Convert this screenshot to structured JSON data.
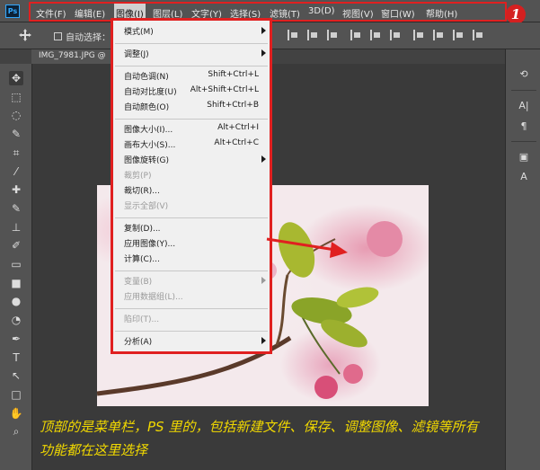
{
  "menubar": {
    "logo": "Ps",
    "items": [
      "文件(F)",
      "编辑(E)",
      "图像(I)",
      "图层(L)",
      "文字(Y)",
      "选择(S)",
      "滤镜(T)",
      "3D(D)",
      "视图(V)",
      "窗口(W)",
      "帮助(H)"
    ],
    "active": "图像(I)",
    "highlight_color": "#e02020"
  },
  "step_badge": "1",
  "optionsbar": {
    "auto_select_label": "自动选择："
  },
  "document_tab": "IMG_7981.JPG @",
  "dropdown": {
    "border_color": "#e02020",
    "groups": [
      [
        {
          "label": "模式(M)",
          "submenu": true,
          "enabled": true
        }
      ],
      [
        {
          "label": "调整(J)",
          "submenu": true,
          "enabled": true
        }
      ],
      [
        {
          "label": "自动色调(N)",
          "shortcut": "Shift+Ctrl+L",
          "enabled": true
        },
        {
          "label": "自动对比度(U)",
          "shortcut": "Alt+Shift+Ctrl+L",
          "enabled": true
        },
        {
          "label": "自动颜色(O)",
          "shortcut": "Shift+Ctrl+B",
          "enabled": true
        }
      ],
      [
        {
          "label": "图像大小(I)...",
          "shortcut": "Alt+Ctrl+I",
          "enabled": true
        },
        {
          "label": "画布大小(S)...",
          "shortcut": "Alt+Ctrl+C",
          "enabled": true
        },
        {
          "label": "图像旋转(G)",
          "submenu": true,
          "enabled": true
        },
        {
          "label": "裁剪(P)",
          "enabled": false
        },
        {
          "label": "裁切(R)...",
          "enabled": true
        },
        {
          "label": "显示全部(V)",
          "enabled": false
        }
      ],
      [
        {
          "label": "复制(D)...",
          "enabled": true
        },
        {
          "label": "应用图像(Y)...",
          "enabled": true
        },
        {
          "label": "计算(C)...",
          "enabled": true
        }
      ],
      [
        {
          "label": "变量(B)",
          "submenu": true,
          "enabled": false
        },
        {
          "label": "应用数据组(L)...",
          "enabled": false
        }
      ],
      [
        {
          "label": "陷印(T)...",
          "enabled": false
        }
      ],
      [
        {
          "label": "分析(A)",
          "submenu": true,
          "enabled": true
        }
      ]
    ]
  },
  "caption": {
    "text": "顶部的是菜单栏，PS 里的，包括新建文件、保存、调整图像、滤镜等所有功能都在这里选择",
    "color": "#f1d800"
  },
  "tools": [
    "move-icon",
    "marquee-icon",
    "lasso-icon",
    "quick-select-icon",
    "crop-icon",
    "eyedropper-icon",
    "healing-brush-icon",
    "brush-icon",
    "clone-stamp-icon",
    "history-brush-icon",
    "eraser-icon",
    "gradient-icon",
    "blur-icon",
    "dodge-icon",
    "pen-icon",
    "type-icon",
    "path-select-icon",
    "shape-icon",
    "hand-icon",
    "zoom-icon"
  ]
}
